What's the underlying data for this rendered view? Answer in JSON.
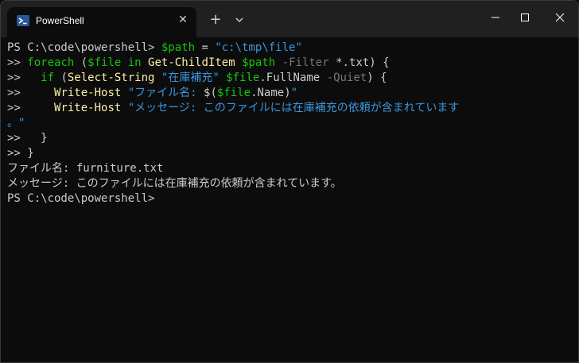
{
  "tab": {
    "title": "PowerShell",
    "close": "✕",
    "new_tab": "+"
  },
  "icons": {
    "tab_icon": "powershell-icon",
    "dropdown": "chevron-down-icon",
    "minimize": "minimize-icon",
    "maximize": "maximize-icon",
    "close": "close-icon"
  },
  "colors": {
    "yellow": "#f9f1a5",
    "green": "#16c60c",
    "cyan": "#3a96dd",
    "gray": "#767676",
    "text": "#cccccc"
  },
  "lines": [
    [
      {
        "t": "PS C:\\code\\powershell> ",
        "c": "white"
      },
      {
        "t": "$path",
        "c": "green"
      },
      {
        "t": " = ",
        "c": "white"
      },
      {
        "t": "\"c:\\tmp\\file\"",
        "c": "cyan"
      }
    ],
    [
      {
        "t": ">> ",
        "c": "white"
      },
      {
        "t": "foreach",
        "c": "green"
      },
      {
        "t": " (",
        "c": "white"
      },
      {
        "t": "$file",
        "c": "green"
      },
      {
        "t": " in ",
        "c": "green"
      },
      {
        "t": "Get-ChildItem",
        "c": "yellow"
      },
      {
        "t": " ",
        "c": "white"
      },
      {
        "t": "$path",
        "c": "green"
      },
      {
        "t": " ",
        "c": "white"
      },
      {
        "t": "-Filter",
        "c": "gray"
      },
      {
        "t": " *.txt) {",
        "c": "white"
      }
    ],
    [
      {
        "t": ">>   ",
        "c": "white"
      },
      {
        "t": "if",
        "c": "green"
      },
      {
        "t": " (",
        "c": "white"
      },
      {
        "t": "Select-String",
        "c": "yellow"
      },
      {
        "t": " ",
        "c": "white"
      },
      {
        "t": "\"在庫補充\"",
        "c": "cyan"
      },
      {
        "t": " ",
        "c": "white"
      },
      {
        "t": "$file",
        "c": "green"
      },
      {
        "t": ".FullName ",
        "c": "white"
      },
      {
        "t": "-Quiet",
        "c": "gray"
      },
      {
        "t": ") {",
        "c": "white"
      }
    ],
    [
      {
        "t": ">>     ",
        "c": "white"
      },
      {
        "t": "Write-Host",
        "c": "yellow"
      },
      {
        "t": " ",
        "c": "white"
      },
      {
        "t": "\"ファイル名: ",
        "c": "cyan"
      },
      {
        "t": "$(",
        "c": "white"
      },
      {
        "t": "$file",
        "c": "green"
      },
      {
        "t": ".Name)",
        "c": "white"
      },
      {
        "t": "\"",
        "c": "cyan"
      }
    ],
    [
      {
        "t": ">>     ",
        "c": "white"
      },
      {
        "t": "Write-Host",
        "c": "yellow"
      },
      {
        "t": " ",
        "c": "white"
      },
      {
        "t": "\"メッセージ: このファイルには在庫補充の依頼が含まれています",
        "c": "cyan"
      }
    ],
    [
      {
        "t": "。\"",
        "c": "cyan"
      }
    ],
    [
      {
        "t": ">>   }",
        "c": "white"
      }
    ],
    [
      {
        "t": ">> }",
        "c": "white"
      }
    ],
    [
      {
        "t": "ファイル名: furniture.txt",
        "c": "white"
      }
    ],
    [
      {
        "t": "メッセージ: このファイルには在庫補充の依頼が含まれています。",
        "c": "white"
      }
    ],
    [
      {
        "t": "PS C:\\code\\powershell>",
        "c": "white"
      }
    ]
  ]
}
